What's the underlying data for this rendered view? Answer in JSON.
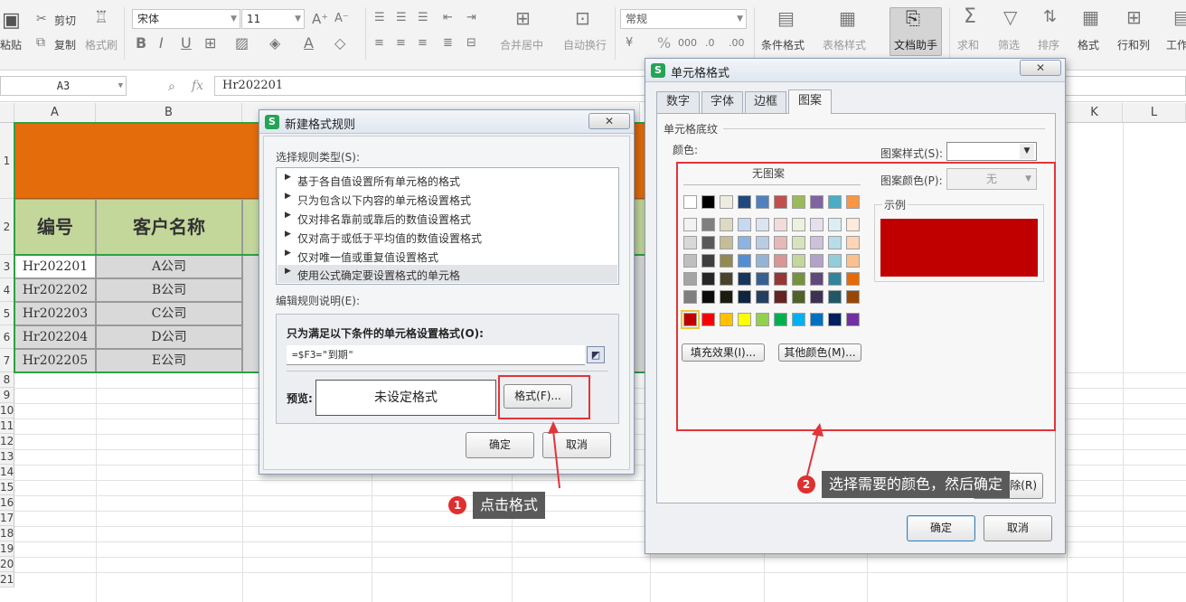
{
  "toolbar": {
    "paste_label": "粘贴",
    "cut_label": "剪切",
    "copy_label": "复制",
    "format_painter_label": "格式刷",
    "font_name": "宋体",
    "font_size": "11",
    "merge_center_label": "合并居中",
    "wrap_text_label": "自动换行",
    "number_format": "常规",
    "percent_symbol": "%",
    "cond_format_label": "条件格式",
    "table_style_label": "表格样式",
    "doc_assistant_label": "文档助手",
    "sum_label": "求和",
    "filter_label": "筛选",
    "sort_label": "排序",
    "format_label": "格式",
    "row_col_label": "行和列",
    "worksheet_label": "工作"
  },
  "formula_bar": {
    "name_box": "A3",
    "fx": "fx",
    "formula": "Hr202201"
  },
  "sheet": {
    "columns": [
      "A",
      "B",
      "K",
      "L"
    ],
    "row_numbers": [
      "1",
      "2",
      "3",
      "4",
      "5",
      "6",
      "7",
      "8",
      "9",
      "10",
      "11",
      "12",
      "13",
      "14",
      "15",
      "16",
      "17",
      "18",
      "19",
      "20",
      "21"
    ],
    "headers": [
      "编号",
      "客户名称"
    ],
    "rows": [
      [
        "Hr202201",
        "A公司"
      ],
      [
        "Hr202202",
        "B公司"
      ],
      [
        "Hr202203",
        "C公司"
      ],
      [
        "Hr202204",
        "D公司"
      ],
      [
        "Hr202205",
        "E公司"
      ]
    ]
  },
  "rule_dialog": {
    "title": "新建格式规则",
    "close": "✕",
    "select_type_label": "选择规则类型(S):",
    "rule_types": [
      "基于各自值设置所有单元格的格式",
      "只为包含以下内容的单元格设置格式",
      "仅对排名靠前或靠后的数值设置格式",
      "仅对高于或低于平均值的数值设置格式",
      "仅对唯一值或重复值设置格式",
      "使用公式确定要设置格式的单元格"
    ],
    "edit_label": "编辑规则说明(E):",
    "condition_label": "只为满足以下条件的单元格设置格式(O):",
    "formula": "=$F3=\"到期\"",
    "preview_label": "预览:",
    "preview_text": "未设定格式",
    "format_button": "格式(F)...",
    "ok": "确定",
    "cancel": "取消"
  },
  "cell_dialog": {
    "title": "单元格格式",
    "close": "✕",
    "tabs": [
      "数字",
      "字体",
      "边框",
      "图案"
    ],
    "active_tab": "图案",
    "section_label": "单元格底纹",
    "color_label": "颜色:",
    "no_pattern": "无图案",
    "pattern_style_label": "图案样式(S):",
    "pattern_color_label": "图案颜色(P):",
    "pattern_color_value": "无",
    "sample_label": "示例",
    "sample_color": "#c00000",
    "fill_effects": "填充效果(I)...",
    "more_colors": "其他颜色(M)...",
    "clear_button": "清除(R)",
    "ok": "确定",
    "cancel": "取消",
    "palette_row1": [
      "#ffffff",
      "#000000",
      "#eeece1",
      "#1f497d",
      "#4f81bd",
      "#c0504d",
      "#9bbb59",
      "#8064a2",
      "#4bacc6",
      "#f79646"
    ],
    "palette_tints": [
      [
        "#f2f2f2",
        "#7f7f7f",
        "#ddd9c3",
        "#c6d9f0",
        "#dbe5f1",
        "#f2dcdb",
        "#ebf1dd",
        "#e5e0ec",
        "#dbeef3",
        "#fdeada"
      ],
      [
        "#d8d8d8",
        "#595959",
        "#c4bd97",
        "#8db3e2",
        "#b8cce4",
        "#e5b9b7",
        "#d7e3bc",
        "#ccc1d9",
        "#b7dde8",
        "#fbd5b5"
      ],
      [
        "#bfbfbf",
        "#3f3f3f",
        "#938953",
        "#548dd4",
        "#95b3d7",
        "#d99694",
        "#c3d69b",
        "#b2a2c7",
        "#92cddc",
        "#fac08f"
      ],
      [
        "#a5a5a5",
        "#262626",
        "#494429",
        "#17365d",
        "#366092",
        "#953734",
        "#76923c",
        "#5f497a",
        "#31859b",
        "#e36c09"
      ],
      [
        "#7f7f7f",
        "#0c0c0c",
        "#1d1b10",
        "#0f243e",
        "#244061",
        "#632423",
        "#4f6128",
        "#3f3151",
        "#205867",
        "#974806"
      ]
    ],
    "palette_standard": [
      "#c00000",
      "#ff0000",
      "#ffc000",
      "#ffff00",
      "#92d050",
      "#00b050",
      "#00b0f0",
      "#0070c0",
      "#002060",
      "#7030a0"
    ]
  },
  "annotations": {
    "step1_number": "1",
    "step1_text": "点击格式",
    "step2_number": "2",
    "step2_text": "选择需要的颜色，然后确定"
  },
  "colors": {
    "title_fill": "#e46c0a",
    "header_fill": "#c4d79b",
    "data_fill_b": "#d9d9d9",
    "highlight": "#e0353a"
  }
}
